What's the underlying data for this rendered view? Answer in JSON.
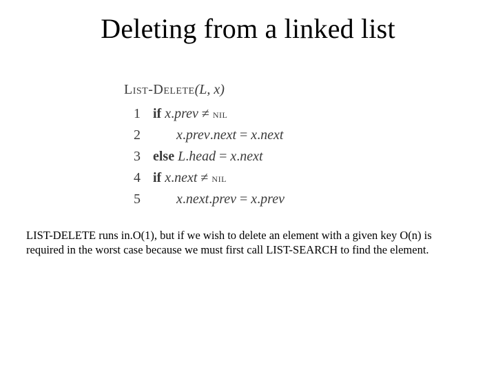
{
  "title": "Deleting from a linked list",
  "algo": {
    "name_part1": "List-Delete",
    "args": "(L, x)",
    "lines": {
      "l1": {
        "n": "1",
        "kw": "if",
        "cond_lhs": "x",
        "cond_dot1": ".",
        "cond_fld": "prev",
        "neq": " ≠ ",
        "nil": "nil"
      },
      "l2": {
        "n": "2",
        "lhs_x": "x",
        "d1": ".",
        "f1": "prev",
        "d2": ".",
        "f2": "next",
        "eq": "  =  ",
        "rhs_x": "x",
        "d3": ".",
        "f3": "next"
      },
      "l3": {
        "n": "3",
        "kw": "else",
        "lhs_L": "L",
        "d1": ".",
        "f1": "head",
        "eq": "  =  ",
        "rhs_x": "x",
        "d2": ".",
        "f2": "next"
      },
      "l4": {
        "n": "4",
        "kw": "if",
        "cond_lhs": "x",
        "cond_dot1": ".",
        "cond_fld": "next",
        "neq": " ≠ ",
        "nil": "nil"
      },
      "l5": {
        "n": "5",
        "lhs_x": "x",
        "d1": ".",
        "f1": "next",
        "d2": ".",
        "f2": "prev",
        "eq": "  =  ",
        "rhs_x": "x",
        "d3": ".",
        "f3": "prev"
      }
    }
  },
  "note": "LIST-DELETE runs in.O(1), but if we wish to delete an element with a given key O(n) is required in the worst case because we must first call LIST-SEARCH to find the element."
}
